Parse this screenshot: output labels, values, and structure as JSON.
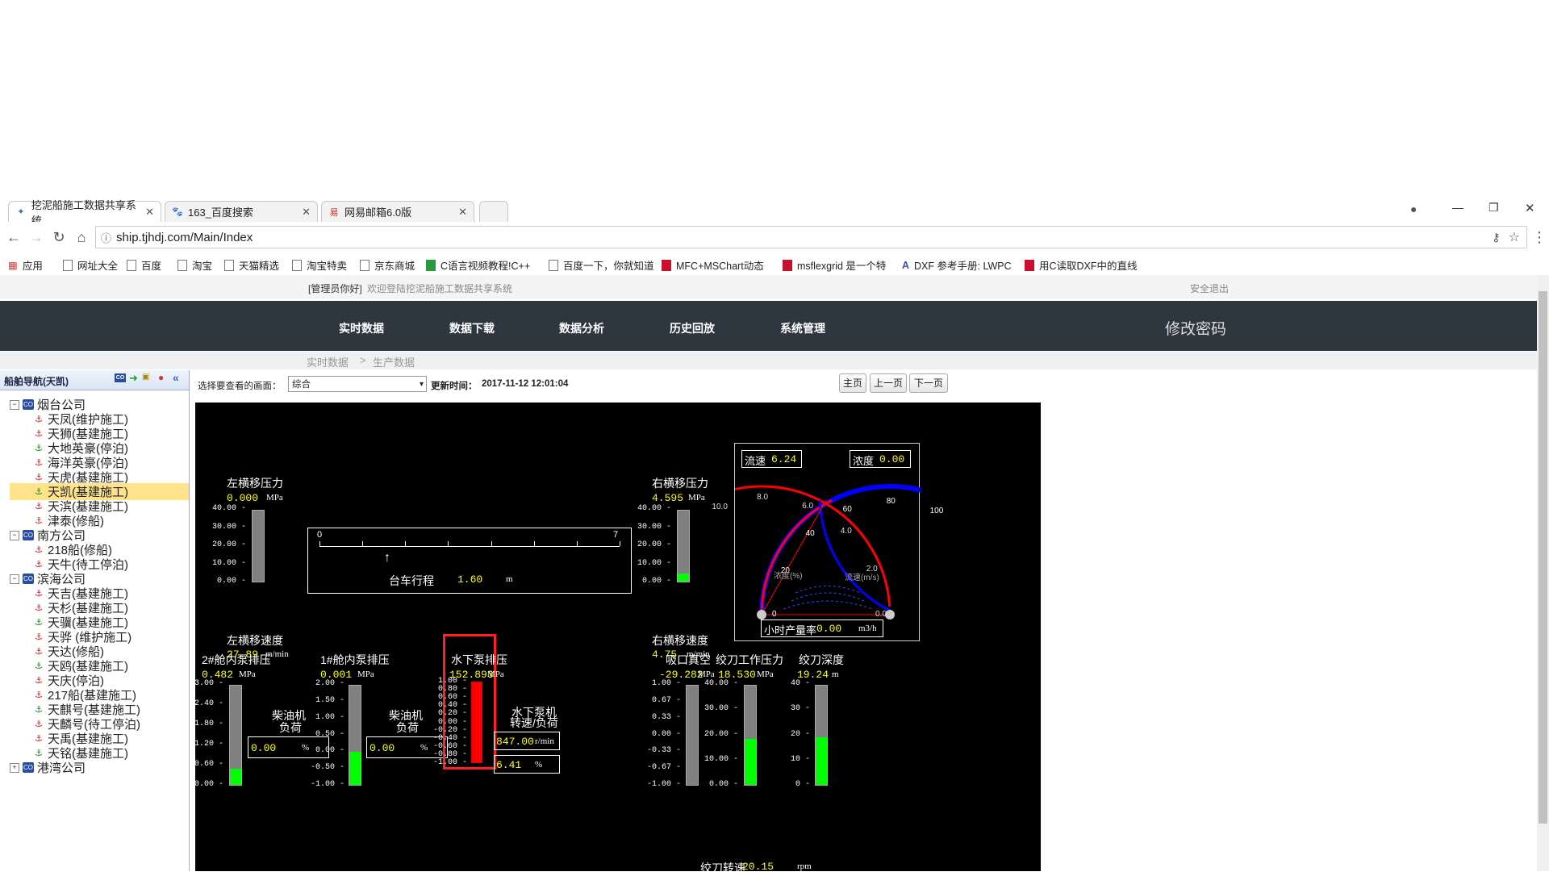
{
  "browser": {
    "tabs": [
      {
        "title": "挖泥船施工数据共享系统",
        "icon": "ship-nav-icon"
      },
      {
        "title": "163_百度搜索",
        "icon": "baidu-icon"
      },
      {
        "title": "网易邮箱6.0版",
        "icon": "netease-icon"
      }
    ],
    "url": "ship.tjhdj.com/Main/Index",
    "bookmarks": [
      "应用",
      "网址大全",
      "百度",
      "淘宝",
      "天猫精选",
      "淘宝特卖",
      "京东商城",
      "C语言视频教程!C++",
      "百度一下，你就知道",
      "MFC+MSChart动态",
      "msflexgrid 是一个特",
      "DXF 参考手册: LWPC",
      "用C读取DXF中的直线"
    ]
  },
  "header": {
    "user": "[管理员你好]",
    "welcome": "欢迎登陆挖泥船施工数据共享系统",
    "logout": "安全退出"
  },
  "nav": {
    "items": [
      "实时数据",
      "数据下载",
      "数据分析",
      "历史回放",
      "系统管理"
    ],
    "change_password": "修改密码"
  },
  "breadcrumb": {
    "root": "实时数据",
    "sep": ">",
    "current": "生产数据"
  },
  "sidebar": {
    "title": "船舶导航(天凯)",
    "tree": [
      {
        "label": "烟台公司",
        "type": "company",
        "expanded": true
      },
      {
        "label": "天凤(维护施工)",
        "type": "ship"
      },
      {
        "label": "天狮(基建施工)",
        "type": "ship"
      },
      {
        "label": "大地英豪(停泊)",
        "type": "ship"
      },
      {
        "label": "海洋英豪(停泊)",
        "type": "ship"
      },
      {
        "label": "天虎(基建施工)",
        "type": "ship"
      },
      {
        "label": "天凯(基建施工)",
        "type": "ship",
        "selected": true
      },
      {
        "label": "天滨(基建施工)",
        "type": "ship"
      },
      {
        "label": "津泰(修船)",
        "type": "ship"
      },
      {
        "label": "南方公司",
        "type": "company",
        "expanded": true
      },
      {
        "label": "218船(修船)",
        "type": "ship"
      },
      {
        "label": "天牛(待工停泊)",
        "type": "ship"
      },
      {
        "label": "滨海公司",
        "type": "company",
        "expanded": true
      },
      {
        "label": "天吉(基建施工)",
        "type": "ship"
      },
      {
        "label": "天杉(基建施工)",
        "type": "ship"
      },
      {
        "label": "天骥(基建施工)",
        "type": "ship"
      },
      {
        "label": "天骅 (维护施工)",
        "type": "ship"
      },
      {
        "label": "天达(修船)",
        "type": "ship"
      },
      {
        "label": "天鸥(基建施工)",
        "type": "ship"
      },
      {
        "label": "天庆(停泊)",
        "type": "ship"
      },
      {
        "label": "217船(基建施工)",
        "type": "ship"
      },
      {
        "label": "天麒号(基建施工)",
        "type": "ship"
      },
      {
        "label": "天麟号(待工停泊)",
        "type": "ship"
      },
      {
        "label": "天禹(基建施工)",
        "type": "ship"
      },
      {
        "label": "天铭(基建施工)",
        "type": "ship"
      },
      {
        "label": "港湾公司",
        "type": "company",
        "expanded": false
      }
    ]
  },
  "toolbar": {
    "select_label": "选择要查看的画面：",
    "select_value": "综合",
    "update_label": "更新时间：",
    "update_time": "2017-11-12 12:01:04",
    "buttons": [
      "主页",
      "上一页",
      "下一页"
    ]
  },
  "screen": {
    "left_shift_pressure": {
      "label": "左横移压力",
      "value": "0.000",
      "unit": "MPa",
      "ticks": [
        "40.00",
        "30.00",
        "20.00",
        "10.00",
        "0.00"
      ],
      "level": 0.0
    },
    "right_shift_pressure": {
      "label": "右横移压力",
      "value": "4.595",
      "unit": "MPa",
      "ticks": [
        "40.00",
        "30.00",
        "20.00",
        "10.00",
        "0.00"
      ],
      "level": 0.115
    },
    "left_shift_speed": {
      "label": "左横移速度",
      "value": "27.89",
      "unit": "m/min"
    },
    "right_shift_speed": {
      "label": "右横移速度",
      "value": "4.75",
      "unit": "m/min"
    },
    "carriage": {
      "label": "台车行程",
      "value": "1.60",
      "unit": "m",
      "min": "0",
      "max": "7",
      "level": 0.2286
    },
    "pump2": {
      "label": "2#舱内泵排压",
      "value": "0.482",
      "unit": "MPa",
      "ticks": [
        "3.00",
        "2.40",
        "1.80",
        "1.20",
        "0.60",
        "0.00"
      ],
      "level": 0.16
    },
    "pump1": {
      "label": "1#舱内泵排压",
      "value": "0.001",
      "unit": "MPa",
      "ticks": [
        "2.00",
        "1.50",
        "1.00",
        "0.50",
        "0.00",
        "-0.50",
        "-1.00"
      ],
      "level": 0.334
    },
    "diesel2": {
      "label1": "柴油机",
      "label2": "负荷",
      "value": "0.00",
      "unit": "%"
    },
    "diesel1": {
      "label1": "柴油机",
      "label2": "负荷",
      "value": "0.00",
      "unit": "%"
    },
    "underwater_pump": {
      "label": "水下泵排压",
      "value": "152.893",
      "unit": "MPa",
      "ticks": [
        "1.00",
        "0.80",
        "0.60",
        "0.40",
        "0.20",
        "0.00",
        "-0.20",
        "-0.40",
        "-0.60",
        "-0.80",
        "-1.00"
      ],
      "level": 1.0
    },
    "underwater_motor": {
      "label1": "水下泵机",
      "label2": "转速/负荷",
      "speed": "847.00",
      "speed_unit": "r/min",
      "load": "6.41",
      "load_unit": "%"
    },
    "suction_vacuum": {
      "label": "吸口真空",
      "value": "-29.282",
      "unit": "MPa",
      "ticks": [
        "1.00",
        "0.67",
        "0.33",
        "0.00",
        "-0.33",
        "-0.67",
        "-1.00"
      ],
      "level": 0.0
    },
    "cutter_pressure": {
      "label": "绞刀工作压力",
      "value": "18.530",
      "unit": "MPa",
      "ticks": [
        "40.00",
        "30.00",
        "20.00",
        "10.00",
        "0.00"
      ],
      "level": 0.463
    },
    "cutter_depth": {
      "label": "绞刀深度",
      "value": "19.24",
      "unit": "m",
      "ticks": [
        "40",
        "30",
        "20",
        "10",
        "0"
      ],
      "level": 0.481
    },
    "cutter_speed": {
      "label": "绞刀转速",
      "value": "20.15",
      "unit": "rpm"
    },
    "gauge": {
      "flow_label": "流速",
      "flow_value": "6.24",
      "density_label": "浓度",
      "density_value": "0.00",
      "density_axis_label": "浓度(%)",
      "flow_axis_label": "流速(m/s)",
      "density_ticks": [
        "0",
        "20",
        "40",
        "60",
        "80",
        "100"
      ],
      "flow_ticks": [
        "10.0",
        "8.0",
        "6.0",
        "4.0",
        "2.0",
        "0.0"
      ],
      "rate_label": "小时产量率",
      "rate_value": "0.00",
      "rate_unit": "m3/h",
      "colors": {
        "arc_blue": "#0000ff",
        "arc_red": "#ff0000"
      }
    },
    "colors": {
      "bar_fill": "#00ff00",
      "pump_fill": "#ff0000",
      "value": "#ffff00",
      "highlight": "#ff0000"
    }
  }
}
